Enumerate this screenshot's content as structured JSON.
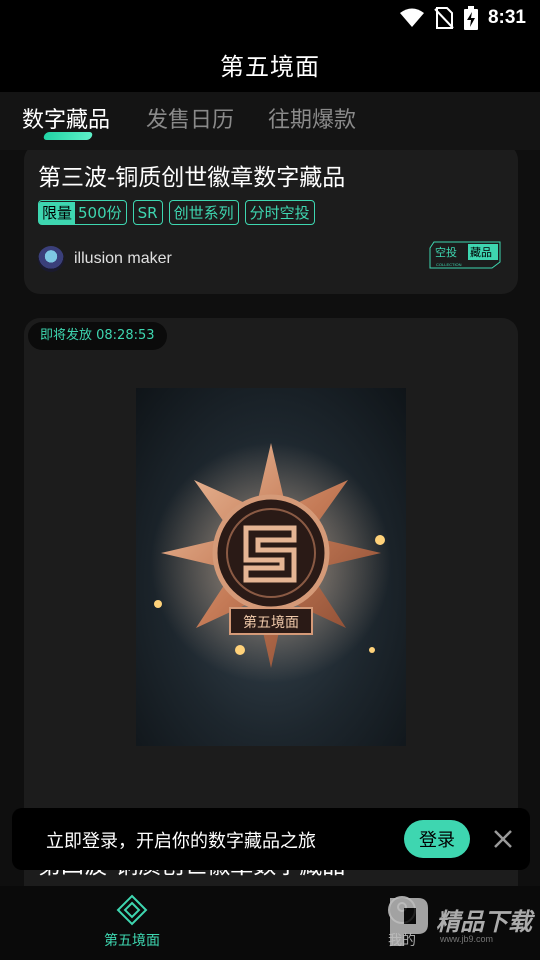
{
  "status_bar": {
    "time": "8:31",
    "icons": [
      "wifi-icon",
      "no-sim-icon",
      "battery-charging-icon"
    ]
  },
  "app": {
    "title": "第五境面"
  },
  "tabs": [
    {
      "label": "数字藏品",
      "active": true
    },
    {
      "label": "发售日历",
      "active": false
    },
    {
      "label": "往期爆款",
      "active": false
    }
  ],
  "cards": [
    {
      "title": "第三波-铜质创世徽章数字藏品",
      "tags": [
        {
          "pre": "限量",
          "post": "500份"
        },
        {
          "label": "SR"
        },
        {
          "label": "创世系列"
        },
        {
          "label": "分时空投"
        }
      ],
      "creator": "illusion maker",
      "badge": {
        "text_a": "空投",
        "text_b": "藏品",
        "sub": "COLLECTION"
      }
    },
    {
      "countdown": "即将发放 08:28:53",
      "art_caption": "第五境面",
      "title": "第四波-铜质创世徽章数字藏品"
    }
  ],
  "toast": {
    "text": "立即登录，开启你的数字藏品之旅",
    "button": "登录"
  },
  "bottom_nav": [
    {
      "label": "第五境面",
      "icon": "home-diamond-icon",
      "active": true
    },
    {
      "label": "我的",
      "icon": "profile-icon",
      "active": false
    }
  ],
  "watermark": {
    "text": "精品下载",
    "sub": "www.jb9.com"
  },
  "colors": {
    "accent": "#3ed6b0",
    "background": "#0d0d0d",
    "card": "#1c1c1c"
  }
}
